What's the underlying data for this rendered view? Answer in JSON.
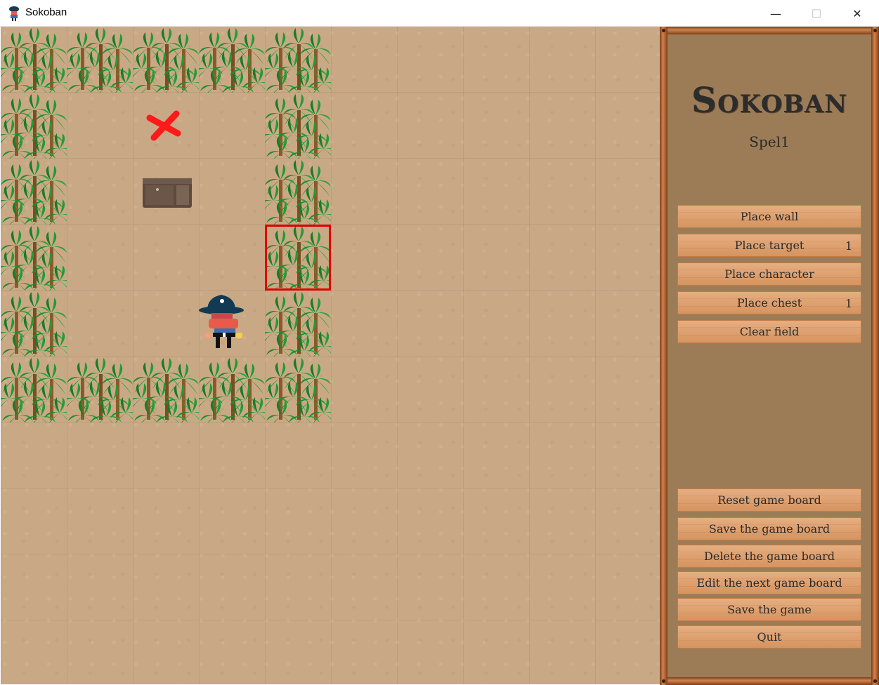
{
  "window": {
    "title": "Sokoban",
    "minimize_glyph": "—",
    "maximize_glyph": "☐",
    "close_glyph": "✕"
  },
  "board": {
    "grid_cols": 10,
    "grid_rows": 10,
    "walls": [
      [
        0,
        0
      ],
      [
        1,
        0
      ],
      [
        2,
        0
      ],
      [
        3,
        0
      ],
      [
        4,
        0
      ],
      [
        0,
        1
      ],
      [
        4,
        1
      ],
      [
        0,
        2
      ],
      [
        4,
        2
      ],
      [
        0,
        3
      ],
      [
        4,
        3
      ],
      [
        0,
        4
      ],
      [
        4,
        4
      ],
      [
        0,
        5
      ],
      [
        1,
        5
      ],
      [
        2,
        5
      ],
      [
        3,
        5
      ],
      [
        4,
        5
      ]
    ],
    "targets": [
      [
        2,
        1
      ]
    ],
    "chests": [
      [
        2,
        2
      ]
    ],
    "character": [
      3,
      4
    ],
    "selected_cell": [
      4,
      3
    ]
  },
  "panel": {
    "logo": "Sokoban",
    "level_name": "Spel1",
    "edit_buttons": [
      {
        "label": "Place wall",
        "count": ""
      },
      {
        "label": "Place target",
        "count": "1"
      },
      {
        "label": "Place character",
        "count": ""
      },
      {
        "label": "Place chest",
        "count": "1"
      },
      {
        "label": "Clear field",
        "count": ""
      }
    ],
    "action_buttons": [
      {
        "label": "Reset game board"
      },
      {
        "label": "Save the game board"
      },
      {
        "label": "Delete the game board"
      },
      {
        "label": "Edit the next game board"
      },
      {
        "label": "Save the game"
      },
      {
        "label": "Quit"
      }
    ]
  },
  "colors": {
    "sand": "#c9a985",
    "panel": "#9c7c56",
    "button": "#e19c65",
    "selection": "#e00000",
    "target": "#ff1a1a"
  }
}
